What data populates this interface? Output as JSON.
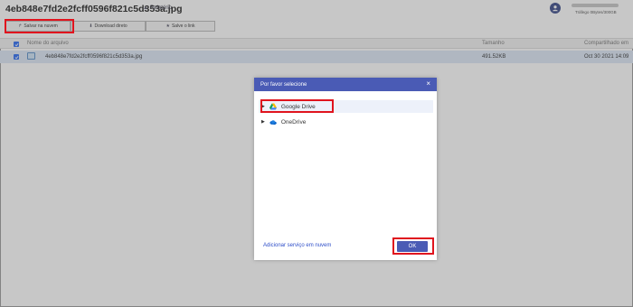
{
  "header": {
    "file_title": "4eb848e7fd2e2fcff0596f821c5d353a.jpg",
    "report_label": "Relatório",
    "traffic": "Tráfego 0Bytes/300GB"
  },
  "toolbar": {
    "save_label": "Salvar na nuvem",
    "download_label": "Download direto",
    "link_label": "Salve o link"
  },
  "table": {
    "col_name": "Nome do arquivo",
    "col_size": "Tamanho",
    "col_shared": "Compartilhado em",
    "rows": [
      {
        "name": "4eb848e7fd2e2fcff0596f821c5d353a.jpg",
        "size": "491.52KB",
        "date": "Oct 30 2021 14:09"
      }
    ]
  },
  "modal": {
    "title": "Por favor selecione",
    "services": [
      {
        "label": "Google Drive",
        "icon": "google-drive-icon"
      },
      {
        "label": "OneDrive",
        "icon": "onedrive-icon"
      }
    ],
    "add_service": "Adicionar serviço em nuvem",
    "ok_label": "OK"
  },
  "colors": {
    "accent": "#4a5bb5",
    "highlight": "#e0141e",
    "row_selected": "#dde8f7"
  }
}
